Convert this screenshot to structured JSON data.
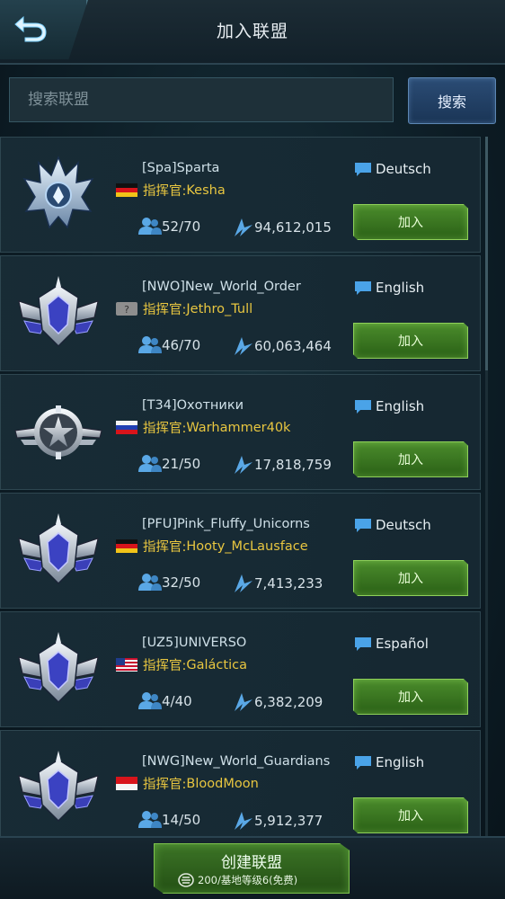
{
  "header": {
    "title": "加入联盟"
  },
  "search": {
    "placeholder": "搜索联盟",
    "button_label": "搜索"
  },
  "commander_prefix": "指挥官: ",
  "alliances": [
    {
      "name": "[Spa]Sparta",
      "commander": "Kesha",
      "flag": "germany",
      "language": "Deutsch",
      "members": "52/70",
      "power": "94,612,015",
      "emblem": "spiked-crest-icon",
      "join_label": "加入"
    },
    {
      "name": "[NWO]New_World_Order",
      "commander": "Jethro_Tull",
      "flag": "unknown",
      "language": "English",
      "members": "46/70",
      "power": "60,063,464",
      "emblem": "winged-shield-icon",
      "join_label": "加入"
    },
    {
      "name": "[T34]Охотники",
      "commander": "Warhammer40k",
      "flag": "russia",
      "language": "English",
      "members": "21/50",
      "power": "17,818,759",
      "emblem": "winged-star-icon",
      "join_label": "加入"
    },
    {
      "name": "[PFU]Pink_Fluffy_Unicorns",
      "commander": "Hooty_McLausface",
      "flag": "germany",
      "language": "Deutsch",
      "members": "32/50",
      "power": "7,413,233",
      "emblem": "winged-shield-icon",
      "join_label": "加入"
    },
    {
      "name": "[UZ5]UNIVERSO",
      "commander": "Galáctica",
      "flag": "usa",
      "language": "Español",
      "members": "4/40",
      "power": "6,382,209",
      "emblem": "winged-shield-icon",
      "join_label": "加入"
    },
    {
      "name": "[NWG]New_World_Guardians",
      "commander": "BloodMoon",
      "flag": "indonesia",
      "language": "English",
      "members": "14/50",
      "power": "5,912,377",
      "emblem": "winged-shield-icon",
      "join_label": "加入"
    }
  ],
  "footer": {
    "create_label": "创建联盟",
    "cost_text": "200/基地等级6(免费)"
  },
  "colors": {
    "commander_text": "#e8c640",
    "join_button": "#3f7d24",
    "search_button": "#2b4c75",
    "member_icon": "#5aa8e6"
  }
}
